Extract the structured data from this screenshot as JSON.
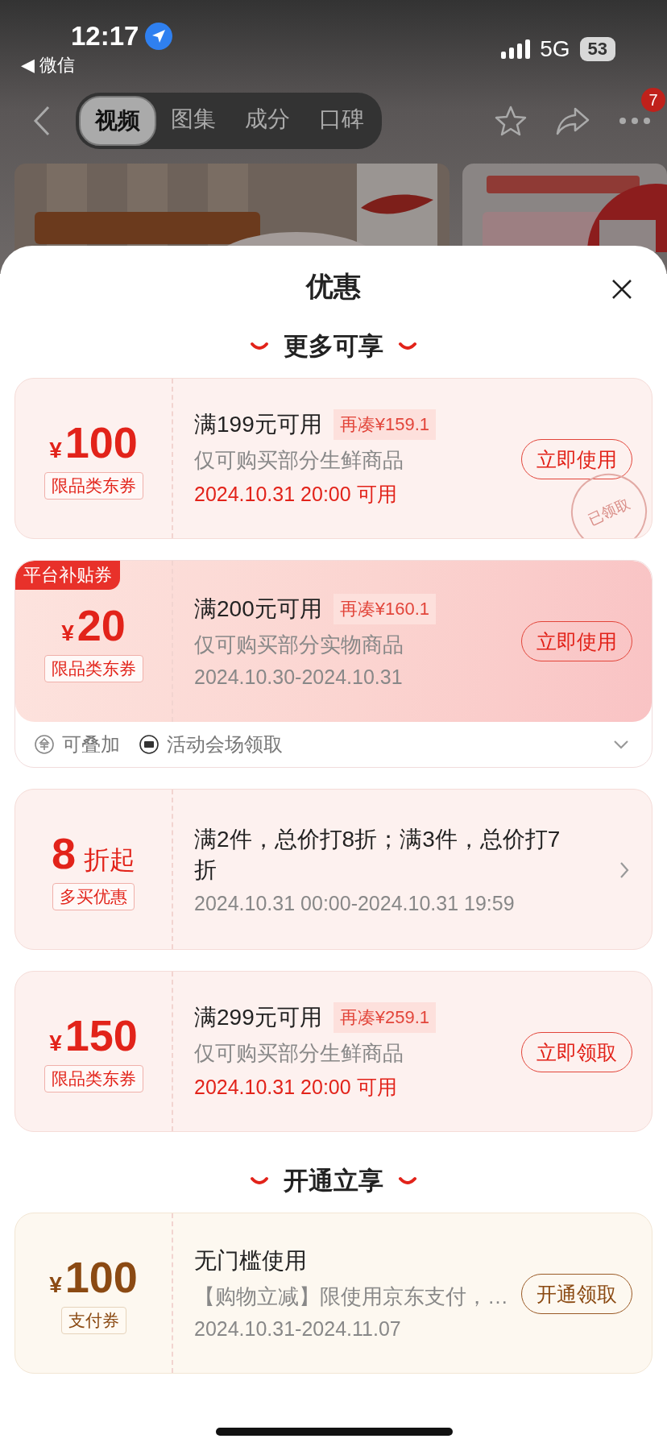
{
  "status_bar": {
    "time": "12:17",
    "back_app": "◀ 微信",
    "network": "5G",
    "battery": "53"
  },
  "nav": {
    "tabs": [
      {
        "label": "视频",
        "selected": true
      },
      {
        "label": "图集",
        "selected": false
      },
      {
        "label": "成分",
        "selected": false
      },
      {
        "label": "口碑",
        "selected": false
      }
    ],
    "more_badge": "7"
  },
  "sheet": {
    "title": "优惠",
    "sections": [
      {
        "heading": "更多可享",
        "cards": [
          {
            "kind": "coupon",
            "color": "#e2231a",
            "currency": "¥",
            "amount": "100",
            "tag": "限品类东券",
            "title": "满199元可用",
            "extra": "再凑¥159.1",
            "desc": "仅可购买部分生鲜商品",
            "date": "2024.10.31 20:00 可用",
            "date_highlight": true,
            "button": "立即使用",
            "stamp": "已领取"
          },
          {
            "kind": "coupon",
            "color": "#e2231a",
            "featured": true,
            "corner": "平台补贴券",
            "currency": "¥",
            "amount": "20",
            "tag": "限品类东券",
            "title": "满200元可用",
            "extra": "再凑¥160.1",
            "desc": "仅可购买部分实物商品",
            "date": "2024.10.30-2024.10.31",
            "date_highlight": false,
            "button": "立即使用",
            "footer": [
              "可叠加",
              "活动会场领取"
            ]
          },
          {
            "kind": "discount",
            "color": "#e2231a",
            "amount": "8",
            "unit": "折起",
            "tag": "多买优惠",
            "title": "满2件，总价打8折；满3件，总价打7折",
            "date": "2024.10.31 00:00-2024.10.31 19:59",
            "date_highlight": false
          },
          {
            "kind": "coupon",
            "color": "#e2231a",
            "currency": "¥",
            "amount": "150",
            "tag": "限品类东券",
            "title": "满299元可用",
            "extra": "再凑¥259.1",
            "desc": "仅可购买部分生鲜商品",
            "date": "2024.10.31 20:00 可用",
            "date_highlight": true,
            "button": "立即领取"
          }
        ]
      },
      {
        "heading": "开通立享",
        "cards": [
          {
            "kind": "coupon",
            "color": "#8b4a13",
            "currency": "¥",
            "amount": "100",
            "tag": "支付券",
            "title": "无门槛使用",
            "desc": "【购物立减】限使用京东支付，…",
            "date": "2024.10.31-2024.11.07",
            "date_highlight": false,
            "button": "开通领取"
          }
        ]
      }
    ]
  }
}
